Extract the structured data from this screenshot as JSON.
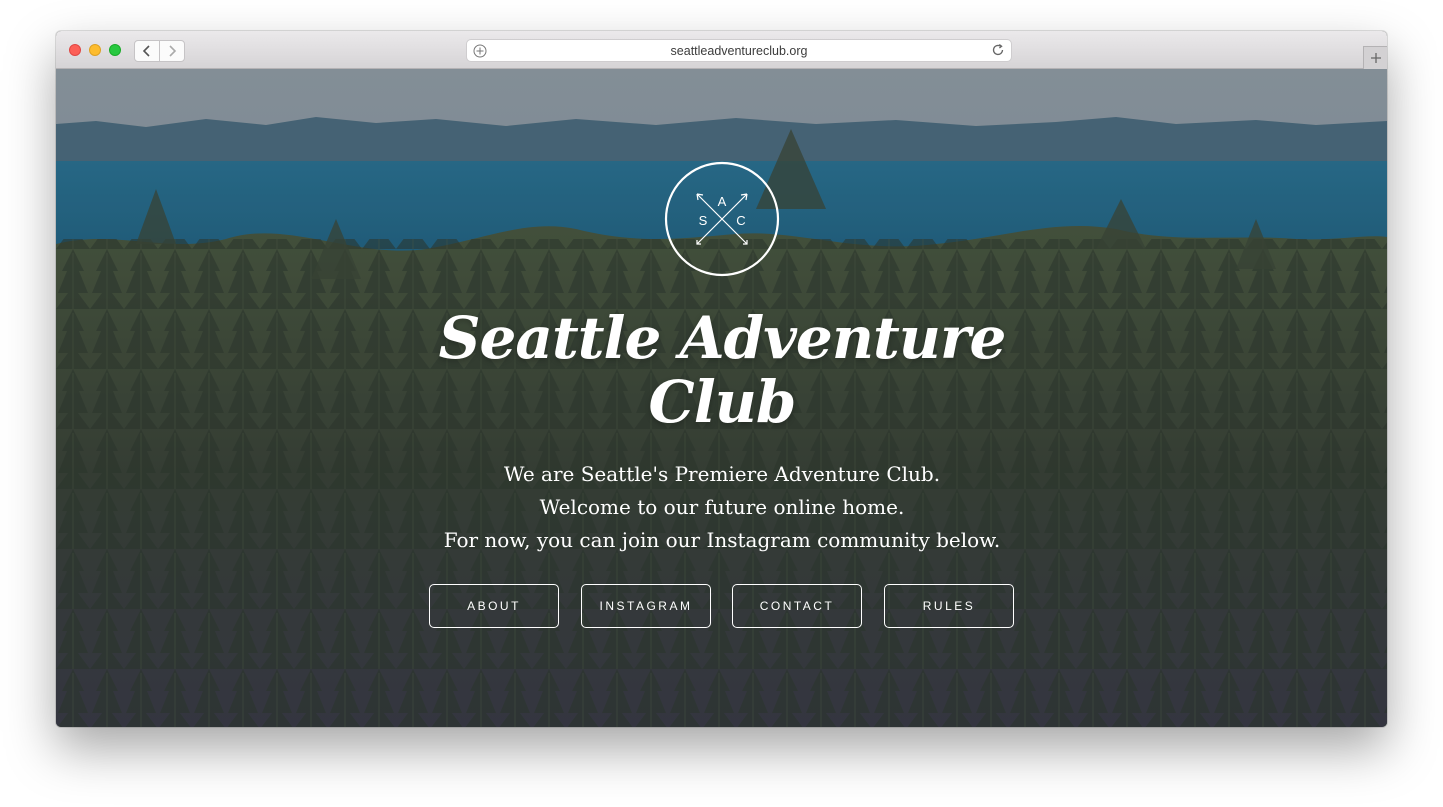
{
  "browser": {
    "url": "seattleadventureclub.org"
  },
  "logo": {
    "letters": [
      "A",
      "S",
      "C"
    ]
  },
  "hero": {
    "title_line1": "Seattle Adventure",
    "title_line2": "Club",
    "tagline": [
      "We are Seattle's Premiere Adventure Club.",
      "Welcome to our future online home.",
      "For now, you can join our Instagram community below."
    ]
  },
  "nav": [
    {
      "label": "ABOUT"
    },
    {
      "label": "INSTAGRAM"
    },
    {
      "label": "CONTACT"
    },
    {
      "label": "RULES"
    }
  ],
  "colors": {
    "sky": "#8f9da6",
    "water": "#236f8e",
    "forest": "#37412f",
    "button_border": "#ffffff"
  }
}
